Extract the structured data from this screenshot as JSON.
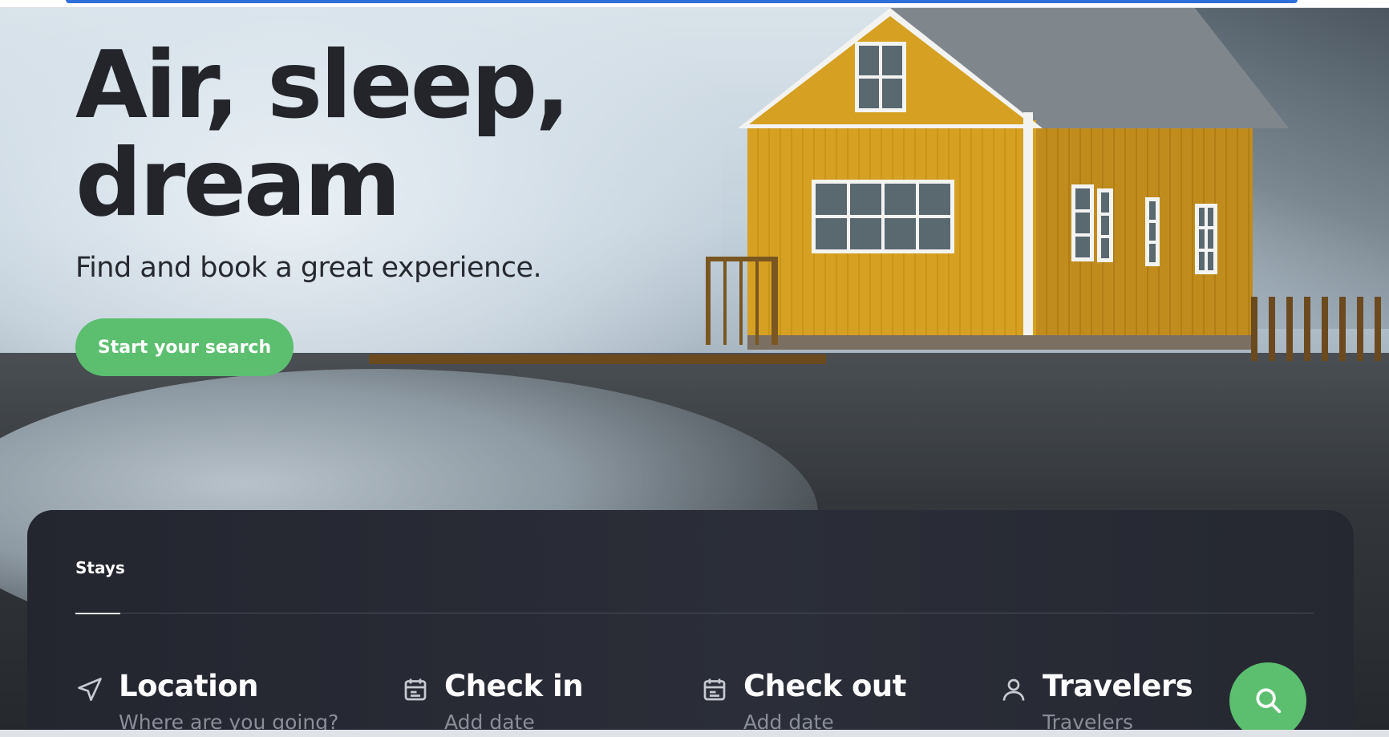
{
  "hero": {
    "title": "Air, sleep, dream",
    "subtitle": "Find and book a great experience.",
    "cta_label": "Start your search"
  },
  "search": {
    "tabs": [
      {
        "label": "Stays",
        "active": true
      }
    ],
    "fields": {
      "location": {
        "label": "Location",
        "hint": "Where are you going?",
        "icon": "navigation-arrow-icon"
      },
      "check_in": {
        "label": "Check in",
        "hint": "Add date",
        "icon": "calendar-icon"
      },
      "check_out": {
        "label": "Check out",
        "hint": "Add date",
        "icon": "calendar-icon"
      },
      "travelers": {
        "label": "Travelers",
        "hint": "Travelers",
        "icon": "user-icon"
      }
    },
    "submit_icon": "search-icon"
  },
  "colors": {
    "accent_green": "#5bbf6f",
    "panel_dark": "#282b34",
    "title_text": "#23252b",
    "top_accent_blue": "#2f6fdb"
  }
}
